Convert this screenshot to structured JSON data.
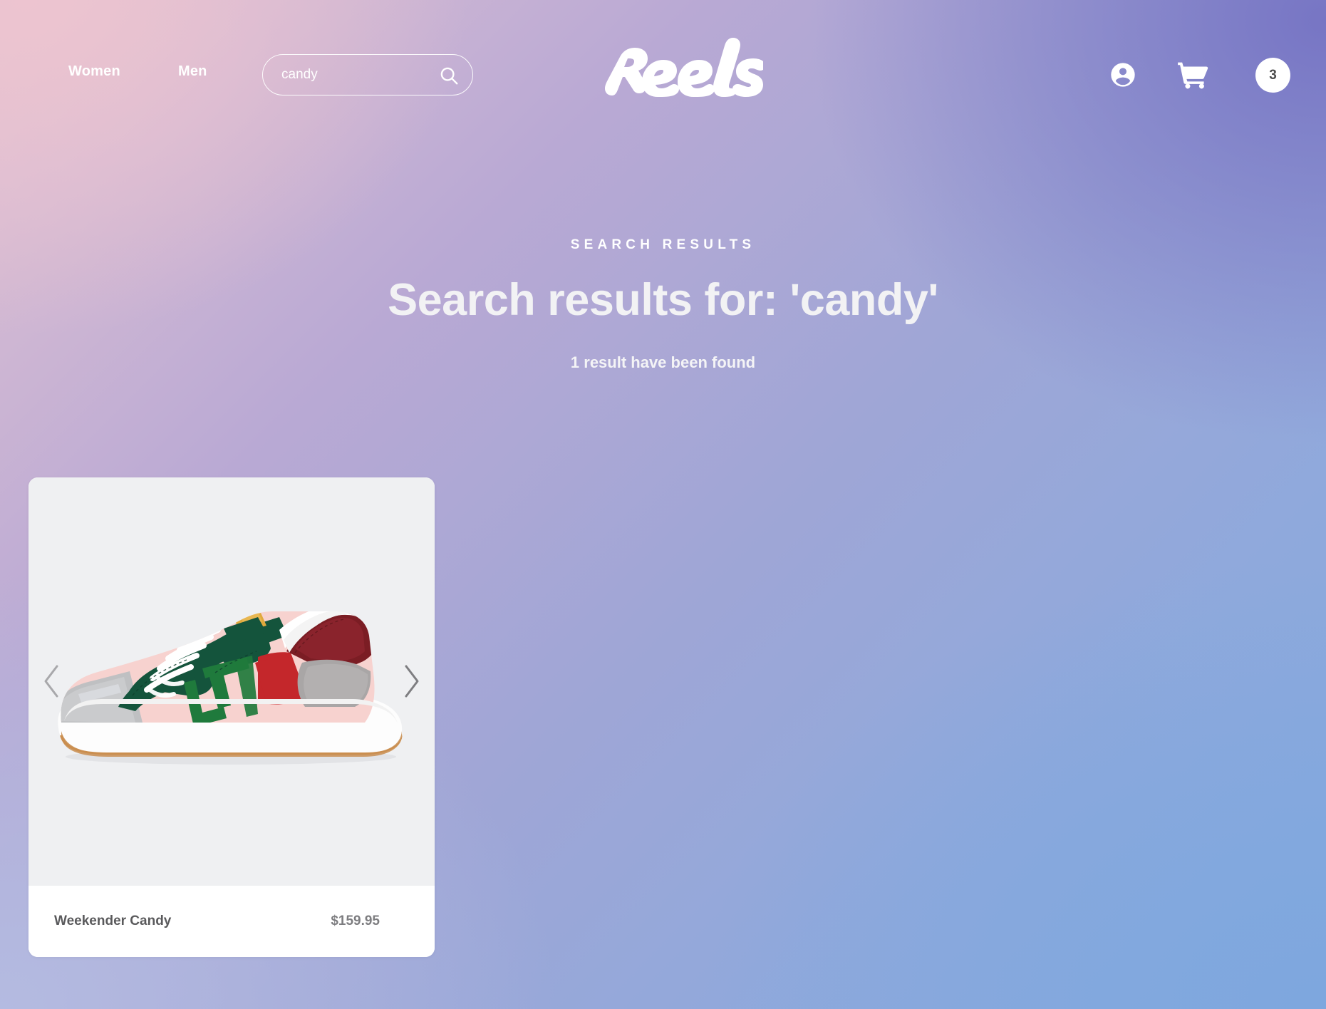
{
  "header": {
    "nav": [
      {
        "label": "Women",
        "name": "nav-link-women"
      },
      {
        "label": "Men",
        "name": "nav-link-men"
      }
    ],
    "search": {
      "value": "candy",
      "placeholder": "Search",
      "icon": "search-icon"
    },
    "logo": {
      "text": "Reels",
      "icon": "reels-wordmark-logo"
    },
    "account_icon": "account-circle-icon",
    "cart_icon": "shopping-cart-icon",
    "cart_count": "3"
  },
  "hero": {
    "eyebrow": "SEARCH RESULTS",
    "title": "Search results for: 'candy'",
    "result_count": "1 result have been found"
  },
  "products": [
    {
      "name": "Weekender Candy",
      "price": "$159.95",
      "image_alt": "Weekender Candy sneaker, pink mesh with green suede overlays",
      "prev_icon": "chevron-left-icon",
      "next_icon": "chevron-right-icon"
    }
  ],
  "colors": {
    "background_start": "#e3c3d2",
    "background_mid": "#9fa6d6",
    "background_end": "#86a9dd",
    "card_background": "#ffffff",
    "media_background": "#eff0f2",
    "text_white": "#ffffff",
    "text_muted": "#7d7d80",
    "badge_background": "#ffffff"
  }
}
